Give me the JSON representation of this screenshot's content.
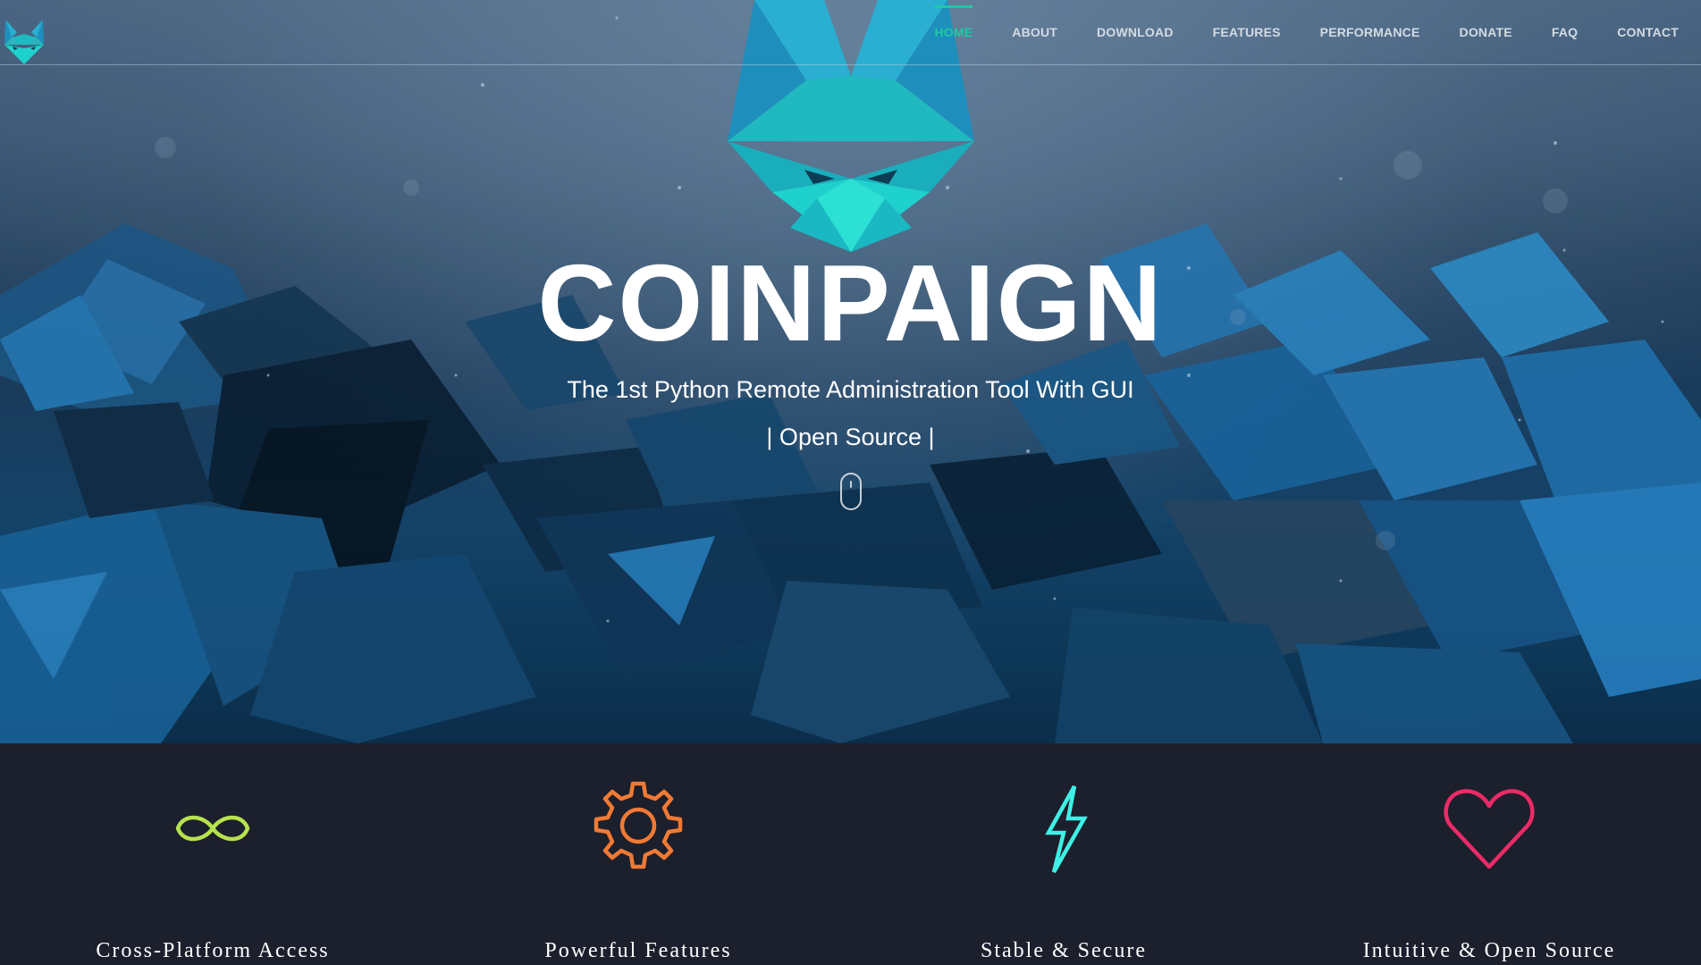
{
  "brand": {
    "logo_icon": "fox-logo-icon",
    "title": "COINPAIGN",
    "subtitle": "The 1st Python Remote Administration Tool With GUI",
    "tagline": "| Open Source |"
  },
  "nav": {
    "items": [
      {
        "label": "HOME",
        "active": true
      },
      {
        "label": "ABOUT"
      },
      {
        "label": "DOWNLOAD"
      },
      {
        "label": "FEATURES"
      },
      {
        "label": "PERFORMANCE"
      },
      {
        "label": "DONATE"
      },
      {
        "label": "FAQ"
      },
      {
        "label": "CONTACT"
      }
    ]
  },
  "scroll_indicator": {
    "icon": "mouse-scroll-icon"
  },
  "features": [
    {
      "label": "Cross-Platform Access",
      "icon": "infinity-icon",
      "color": "#b6e34d"
    },
    {
      "label": "Powerful Features",
      "icon": "gear-icon",
      "color": "#f07a35"
    },
    {
      "label": "Stable & Secure",
      "icon": "lightning-icon",
      "color": "#3ff0e6"
    },
    {
      "label": "Intuitive & Open Source",
      "icon": "heart-icon",
      "color": "#ec2b67"
    }
  ],
  "colors": {
    "accent": "#1fc8a4",
    "features_background": "#1c1f2c"
  }
}
